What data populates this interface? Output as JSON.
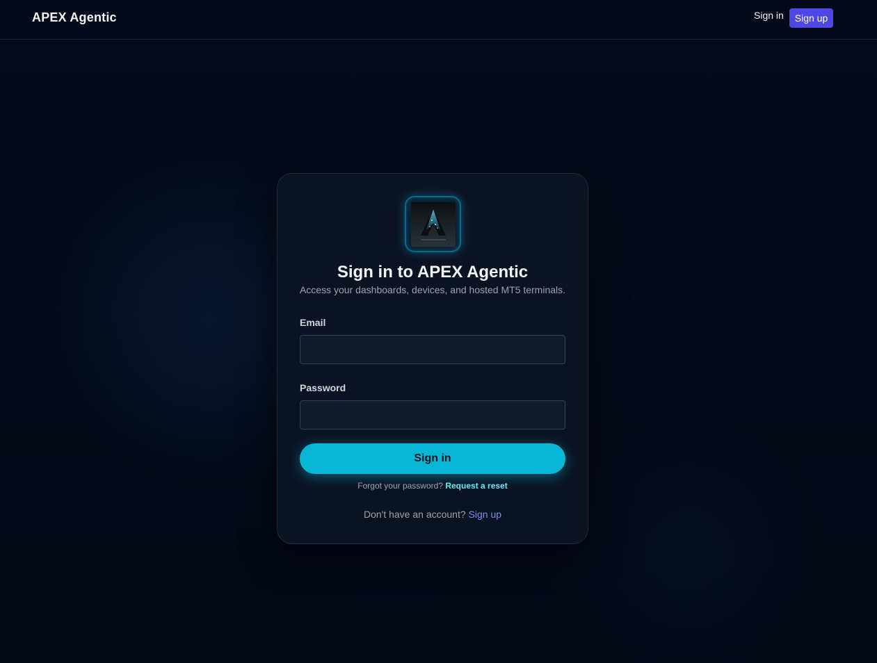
{
  "header": {
    "brand": "APEX Agentic",
    "signin_label": "Sign in",
    "signup_label": "Sign up"
  },
  "card": {
    "logo_alt": "APEX-AGENTIC",
    "title": "Sign in to APEX Agentic",
    "subtitle": "Access your dashboards, devices, and hosted MT5 terminals.",
    "email_label": "Email",
    "email_value": "",
    "password_label": "Password",
    "password_value": "",
    "submit_label": "Sign in",
    "forgot_text": "Forgot your password?",
    "forgot_link": "Request a reset",
    "no_account_text": "Don't have an account?",
    "signup_link": "Sign up"
  },
  "colors": {
    "accent": "#06b6d4",
    "brand_button": "#4f46e5",
    "link": "#818cf8",
    "background": "#050b1c"
  }
}
